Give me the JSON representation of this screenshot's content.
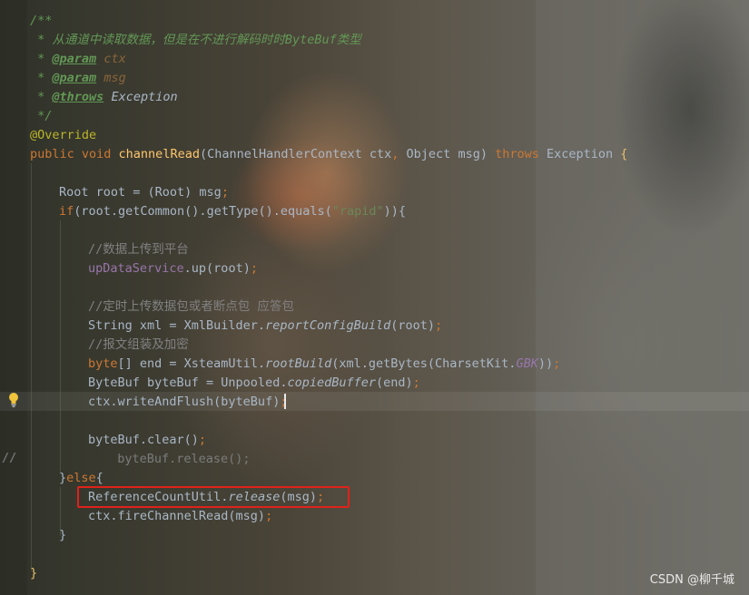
{
  "editor": {
    "lines": [
      {
        "indent": 0,
        "tokens": [
          {
            "t": "/**",
            "s": "c-doc"
          }
        ]
      },
      {
        "indent": 0,
        "tokens": [
          {
            "t": " * ",
            "s": "c-doc"
          },
          {
            "t": "从通道中读取数据，但是在不进行解码时时",
            "s": "c-doc"
          },
          {
            "t": "ByteBuf",
            "s": "c-doc"
          },
          {
            "t": "类型",
            "s": "c-doc"
          }
        ]
      },
      {
        "indent": 0,
        "tokens": [
          {
            "t": " * ",
            "s": "c-doc"
          },
          {
            "t": "@param",
            "s": "c-doctag"
          },
          {
            "t": " ",
            "s": "c-doc"
          },
          {
            "t": "ctx",
            "s": "c-param"
          }
        ]
      },
      {
        "indent": 0,
        "tokens": [
          {
            "t": " * ",
            "s": "c-doc"
          },
          {
            "t": "@param",
            "s": "c-doctag"
          },
          {
            "t": " ",
            "s": "c-doc"
          },
          {
            "t": "msg",
            "s": "c-param"
          }
        ]
      },
      {
        "indent": 0,
        "tokens": [
          {
            "t": " * ",
            "s": "c-doc"
          },
          {
            "t": "@throws",
            "s": "c-doctag"
          },
          {
            "t": " ",
            "s": "c-doc"
          },
          {
            "t": "Exception",
            "s": "c-docref"
          }
        ]
      },
      {
        "indent": 0,
        "tokens": [
          {
            "t": " */",
            "s": "c-doc"
          }
        ]
      },
      {
        "indent": 0,
        "tokens": [
          {
            "t": "@Override",
            "s": "c-ann"
          }
        ]
      },
      {
        "indent": 0,
        "tokens": [
          {
            "t": "public ",
            "s": "c-kw"
          },
          {
            "t": "void ",
            "s": "c-kw"
          },
          {
            "t": "channelRead",
            "s": "c-fn"
          },
          {
            "t": "(ChannelHandlerContext ctx",
            "s": "c-ref"
          },
          {
            "t": ", ",
            "s": "c-kw"
          },
          {
            "t": "Object msg) ",
            "s": "c-ref"
          },
          {
            "t": "throws ",
            "s": "c-kw"
          },
          {
            "t": "Exception ",
            "s": "c-ref"
          },
          {
            "t": "{",
            "s": "c-brace"
          }
        ]
      },
      {
        "indent": 0,
        "tokens": []
      },
      {
        "indent": 1,
        "tokens": [
          {
            "t": "Root root = (Root) msg",
            "s": "c-ref"
          },
          {
            "t": ";",
            "s": "c-kw"
          }
        ]
      },
      {
        "indent": 1,
        "tokens": [
          {
            "t": "if",
            "s": "c-kw"
          },
          {
            "t": "(root.getCommon().getType().equals(",
            "s": "c-ref"
          },
          {
            "t": "\"rapid\"",
            "s": "c-str"
          },
          {
            "t": ")){",
            "s": "c-ref"
          }
        ]
      },
      {
        "indent": 0,
        "tokens": []
      },
      {
        "indent": 2,
        "tokens": [
          {
            "t": "//数据上传到平台",
            "s": "c-comment"
          }
        ]
      },
      {
        "indent": 2,
        "tokens": [
          {
            "t": "upDataService",
            "s": "c-field"
          },
          {
            "t": ".up(root)",
            "s": "c-ref"
          },
          {
            "t": ";",
            "s": "c-kw"
          }
        ]
      },
      {
        "indent": 0,
        "tokens": []
      },
      {
        "indent": 2,
        "tokens": [
          {
            "t": "//定时上传数据包或者断点包 应答包",
            "s": "c-comment"
          }
        ]
      },
      {
        "indent": 2,
        "tokens": [
          {
            "t": "String xml = XmlBuilder.",
            "s": "c-ref"
          },
          {
            "t": "reportConfigBuild",
            "s": "c-italic"
          },
          {
            "t": "(root)",
            "s": "c-ref"
          },
          {
            "t": ";",
            "s": "c-kw"
          }
        ]
      },
      {
        "indent": 2,
        "tokens": [
          {
            "t": "//报文组装及加密",
            "s": "c-comment"
          }
        ]
      },
      {
        "indent": 2,
        "tokens": [
          {
            "t": "byte",
            "s": "c-kw"
          },
          {
            "t": "[] end = XsteamUtil.",
            "s": "c-ref"
          },
          {
            "t": "rootBuild",
            "s": "c-italic"
          },
          {
            "t": "(xml.getBytes(CharsetKit.",
            "s": "c-ref"
          },
          {
            "t": "GBK",
            "s": "c-static"
          },
          {
            "t": "))",
            "s": "c-ref"
          },
          {
            "t": ";",
            "s": "c-kw"
          }
        ]
      },
      {
        "indent": 2,
        "tokens": [
          {
            "t": "ByteBuf byteBuf = Unpooled.",
            "s": "c-ref"
          },
          {
            "t": "copiedBuffer",
            "s": "c-italic"
          },
          {
            "t": "(end)",
            "s": "c-ref"
          },
          {
            "t": ";",
            "s": "c-kw"
          }
        ]
      },
      {
        "indent": 2,
        "tokens": [
          {
            "t": "ctx.writeAndFlush(byteBuf)",
            "s": "c-ref"
          },
          {
            "t": ";",
            "s": "c-kw"
          }
        ]
      },
      {
        "indent": 0,
        "tokens": []
      },
      {
        "indent": 2,
        "tokens": [
          {
            "t": "byteBuf.clear()",
            "s": "c-ref"
          },
          {
            "t": ";",
            "s": "c-kw"
          }
        ]
      },
      {
        "indent": 2,
        "tokens": [
          {
            "t": "  byteBuf.release();",
            "s": "c-dim"
          }
        ]
      },
      {
        "indent": 1,
        "tokens": [
          {
            "t": "}",
            "s": "c-ref"
          },
          {
            "t": "else",
            "s": "c-kw"
          },
          {
            "t": "{",
            "s": "c-ref"
          }
        ]
      },
      {
        "indent": 2,
        "tokens": [
          {
            "t": "ReferenceCountUtil.",
            "s": "c-ref"
          },
          {
            "t": "release",
            "s": "c-italic"
          },
          {
            "t": "(msg)",
            "s": "c-ref"
          },
          {
            "t": ";",
            "s": "c-kw"
          }
        ]
      },
      {
        "indent": 2,
        "tokens": [
          {
            "t": "ctx.fireChannelRead(msg)",
            "s": "c-ref"
          },
          {
            "t": ";",
            "s": "c-kw"
          }
        ]
      },
      {
        "indent": 1,
        "tokens": [
          {
            "t": "}",
            "s": "c-ref"
          }
        ]
      },
      {
        "indent": 0,
        "tokens": []
      },
      {
        "indent": 0,
        "tokens": [
          {
            "t": "}",
            "s": "c-brace"
          }
        ]
      }
    ],
    "gutter_comment": "//",
    "intention_icon": "lightbulb-icon"
  },
  "watermark": "CSDN @柳千城",
  "colors": {
    "highlight_box": "#e0221a",
    "keyword": "#cc7832",
    "method": "#ffc66d",
    "string": "#6a8759",
    "doc_comment": "#629755"
  }
}
